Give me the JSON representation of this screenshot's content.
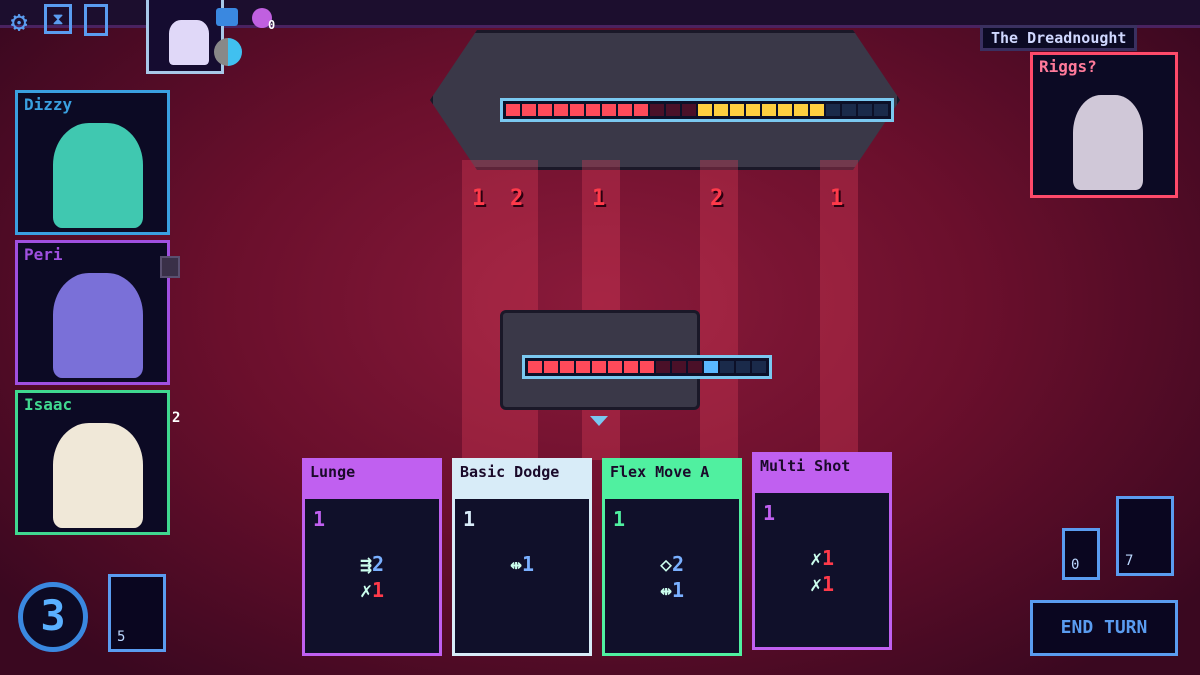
{
  "top_icons": [
    {
      "icon": "gear-icon"
    },
    {
      "icon": "hourglass-icon"
    },
    {
      "icon": "deck-icon"
    }
  ],
  "status_counter": "0",
  "enemy": {
    "name": "The Dreadnought",
    "captain": "Riggs?",
    "hull": 9,
    "hull_max": 12,
    "shield_yellow": 8,
    "shield_max": 12,
    "intents": [
      "1",
      "2",
      "1",
      "2",
      "1"
    ]
  },
  "player": {
    "hull": 8,
    "hull_max": 11,
    "shield": 1,
    "shield_max": 4
  },
  "crew": [
    {
      "name": "Dizzy",
      "color": "#3aa0e0",
      "skin": "#40c8b0"
    },
    {
      "name": "Peri",
      "color": "#a050e0",
      "skin": "#7a70d8"
    },
    {
      "name": "Isaac",
      "color": "#40d890",
      "skin": "#f0e8d8"
    }
  ],
  "isaac_badge": "2",
  "energy": "3",
  "draw_pile": "5",
  "discard_pile": "0",
  "exhaust_pile": "7",
  "end_turn": "END TURN",
  "cards": [
    {
      "title": "Lunge",
      "cost": "1",
      "color": "#c060f0",
      "actions": [
        {
          "icon": "evade-icon",
          "value": "2",
          "cls": "blue"
        },
        {
          "icon": "attack-icon",
          "value": "1",
          "cls": "red"
        }
      ]
    },
    {
      "title": "Basic Dodge",
      "cost": "1",
      "color": "#d8ecf8",
      "actions": [
        {
          "icon": "move-icon",
          "value": "1",
          "cls": "blue"
        }
      ]
    },
    {
      "title": "Flex Move A",
      "cost": "1",
      "color": "#50f0a0",
      "actions": [
        {
          "icon": "flex-icon",
          "value": "2",
          "cls": "blue"
        },
        {
          "icon": "move-icon",
          "value": "1",
          "cls": "blue"
        }
      ]
    },
    {
      "title": "Multi Shot",
      "cost": "1",
      "color": "#c060f0",
      "actions": [
        {
          "icon": "attack-icon",
          "value": "1",
          "cls": "red"
        },
        {
          "icon": "attack-icon",
          "value": "1",
          "cls": "red"
        }
      ]
    }
  ]
}
